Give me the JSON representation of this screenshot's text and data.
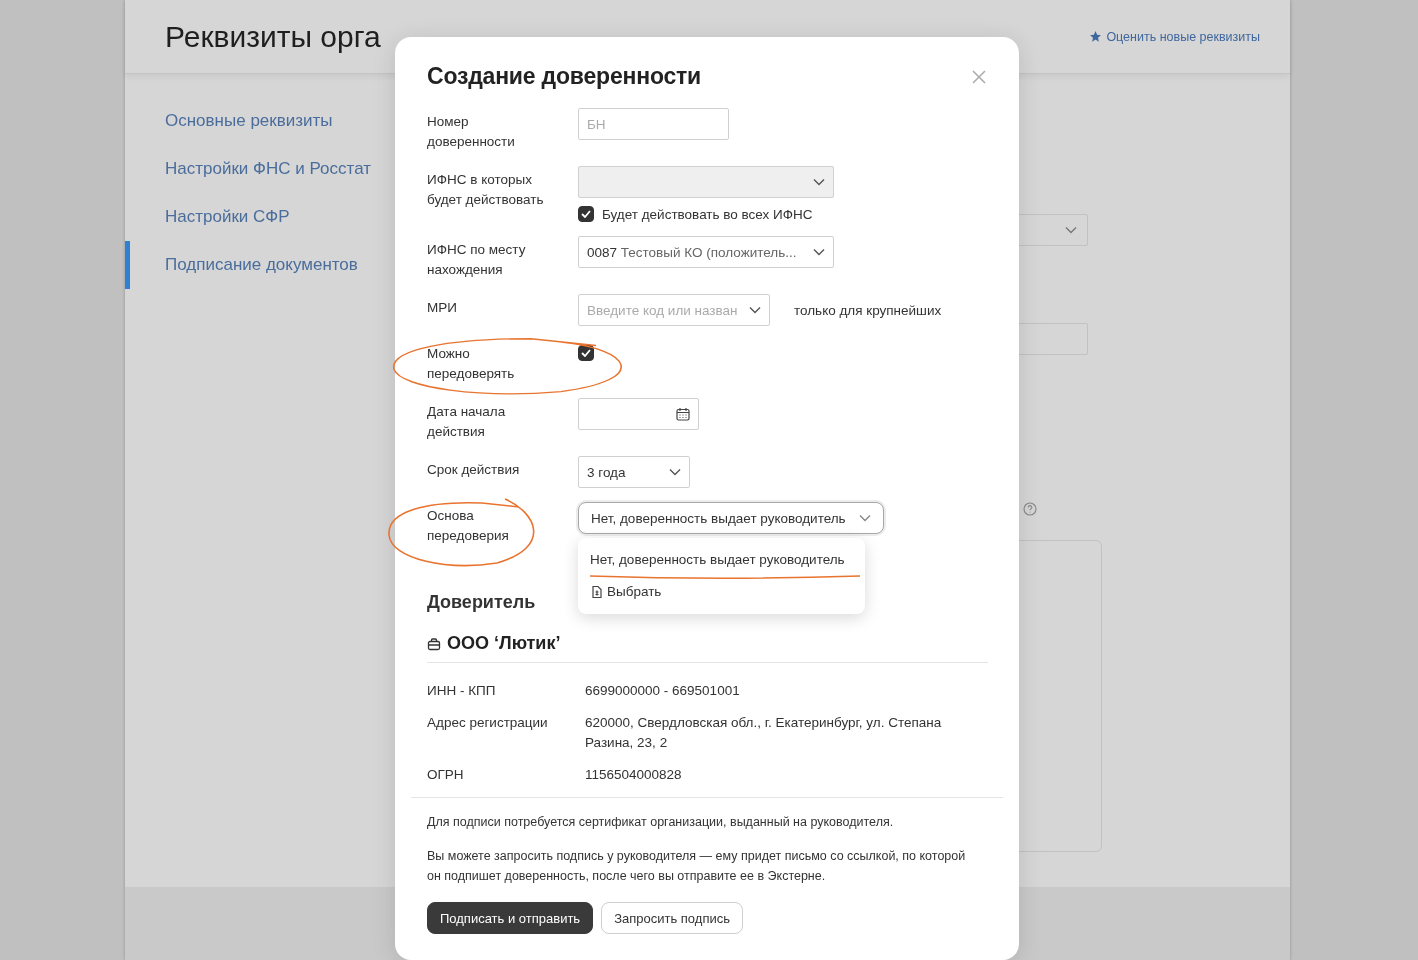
{
  "page": {
    "title": "Реквизиты орга",
    "rate_link": "Оценить новые реквизиты"
  },
  "sidebar": {
    "items": [
      {
        "label": "Основные реквизиты",
        "selected": false
      },
      {
        "label": "Настройки ФНС и Росстат",
        "selected": false
      },
      {
        "label": "Настройки СФР",
        "selected": false
      },
      {
        "label": "Подписание документов",
        "selected": true
      }
    ]
  },
  "dialog": {
    "title": "Создание доверенности",
    "fields": [
      {
        "kind": "text",
        "label": "Номер доверенности",
        "placeholder": "БН"
      },
      {
        "kind": "select",
        "label": "ИФНС в которых будет действовать",
        "disabled": true,
        "checkbox": {
          "label": "Будет действовать во всех ИФНС",
          "checked": true
        }
      },
      {
        "kind": "select",
        "label": "ИФНС по месту нахождения",
        "disabled": false,
        "code": "0087",
        "value": "Тестовый КО (положитель..."
      },
      {
        "kind": "combobox",
        "label": "МРИ",
        "placeholder": "Введите код или назван",
        "note": "только для крупнейших"
      },
      {
        "kind": "checkbox",
        "label": "Можно передоверять",
        "checked": true
      },
      {
        "kind": "date",
        "label": "Дата начала действия"
      },
      {
        "kind": "select",
        "label": "Срок действия",
        "disabled": false,
        "value": "3 года"
      },
      {
        "kind": "dropdown",
        "label": "Основа передоверия",
        "value": "Нет, доверенность выдает руководитель",
        "expanded": true,
        "options": [
          {
            "kind": "option",
            "label": "Нет, доверенность выдает руководитель"
          },
          {
            "kind": "action",
            "label": "Выбрать"
          }
        ]
      }
    ],
    "principal": {
      "heading": "Доверитель",
      "org": "ООО ‘Лютик’",
      "details": [
        {
          "label": "ИНН - КПП",
          "value": "6699000000 - 669501001"
        },
        {
          "label": "Адрес регистрации",
          "value": "620000, Свердловская обл., г. Екатеринбург, ул. Степана Разина, 23, 2"
        },
        {
          "label": "ОГРН",
          "value": "1156504000828"
        }
      ]
    },
    "notes": [
      "Для подписи потребуется сертификат организации, выданный на руководителя.",
      "Вы можете запросить подпись у руководителя — ему придет письмо со ссылкой, по которой он подпишет доверенность, после чего вы отправите ее в Экстерне."
    ],
    "buttons": [
      {
        "kind": "primary",
        "label": "Подписать и отправить"
      },
      {
        "kind": "secondary",
        "label": "Запросить подпись"
      }
    ]
  }
}
